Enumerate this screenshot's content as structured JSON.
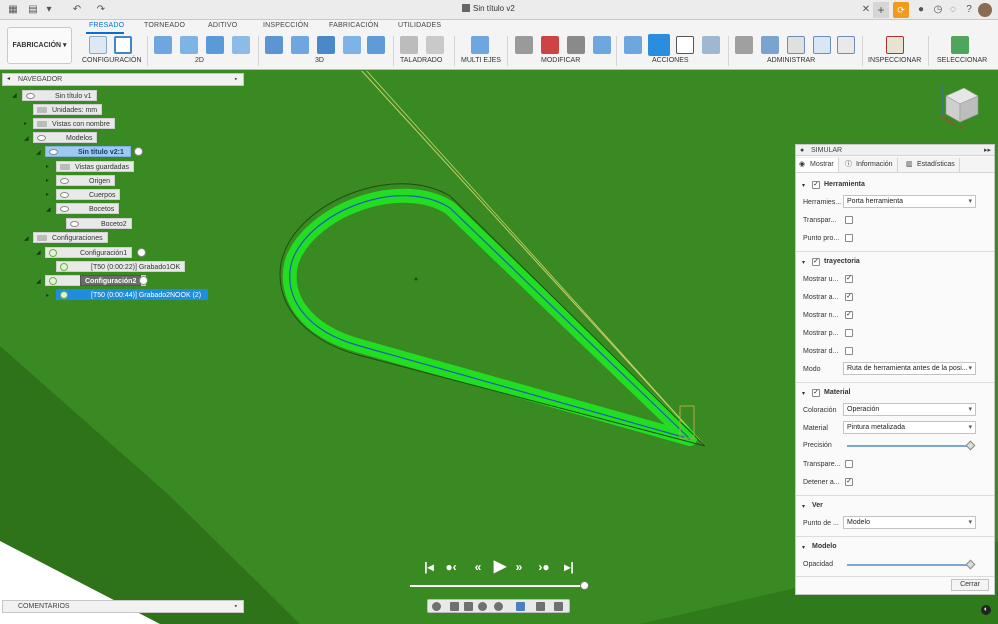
{
  "window": {
    "title": "Sin título v2"
  },
  "tabs": [
    "FRESADO",
    "TORNEADO",
    "ADITIVO",
    "INSPECCIÓN",
    "FABRICACIÓN",
    "UTILIDADES"
  ],
  "workspace": "FABRICACIÓN",
  "groups": [
    "CONFIGURACIÓN",
    "2D",
    "3D",
    "TALADRADO",
    "MULTI EJES",
    "MODIFICAR",
    "ACCIONES",
    "ADMINISTRAR",
    "INSPECCIONAR",
    "SELECCIONAR"
  ],
  "navigator": {
    "title": "NAVEGADOR",
    "items": [
      {
        "label": "Sin título v1"
      },
      {
        "label": "Unidades: mm"
      },
      {
        "label": "Vistas con nombre"
      },
      {
        "label": "Modelos"
      },
      {
        "label": "Sin título v2:1"
      },
      {
        "label": "Vistas guardadas"
      },
      {
        "label": "Origen"
      },
      {
        "label": "Cuerpos"
      },
      {
        "label": "Bocetos"
      },
      {
        "label": "Boceto2"
      },
      {
        "label": "Configuraciones"
      },
      {
        "label": "Configuración1"
      },
      {
        "label": "[T50 (0:00:22)] Grabado1OK"
      },
      {
        "label": "Configuración2"
      },
      {
        "label": "[T50 (0:00:44)] Grabado2NOOK (2)"
      }
    ]
  },
  "comments": "COMENTARIOS",
  "simulate": {
    "title": "SIMULAR",
    "tabs": [
      "Mostrar",
      "Información",
      "Estadísticas"
    ],
    "herramienta": {
      "title": "Herramienta",
      "checked": true,
      "herramienta_label": "Herramies...",
      "herramienta_value": "Porta herramienta",
      "transparencia_label": "Transpar...",
      "punto_label": "Punto pro..."
    },
    "trayectoria": {
      "title": "trayectoria",
      "checked": true,
      "rows": [
        "Mostrar u...",
        "Mostrar a...",
        "Mostrar n...",
        "Mostrar p...",
        "Mostrar d..."
      ],
      "modo_label": "Modo",
      "modo_value": "Ruta de herramienta antes de la posi..."
    },
    "material": {
      "title": "Material",
      "checked": true,
      "coloracion_label": "Coloración",
      "coloracion_value": "Operación",
      "material_label": "Material",
      "material_value": "Pintura metalizada",
      "precision_label": "Precisión",
      "precision_level": 1.0,
      "transparencia_label": "Transpare...",
      "detener_label": "Detener a..."
    },
    "ver": {
      "title": "Ver",
      "punto_label": "Punto de ...",
      "punto_value": "Modelo"
    },
    "modelo": {
      "title": "Modelo",
      "opacidad_label": "Opacidad",
      "opacidad_level": 1.0
    },
    "close": "Cerrar"
  },
  "playback": {
    "progress": 1.0
  },
  "colors": {
    "accent": "#0a6ed1",
    "background": "#3a8a23",
    "toolpath": "#22dd22"
  }
}
